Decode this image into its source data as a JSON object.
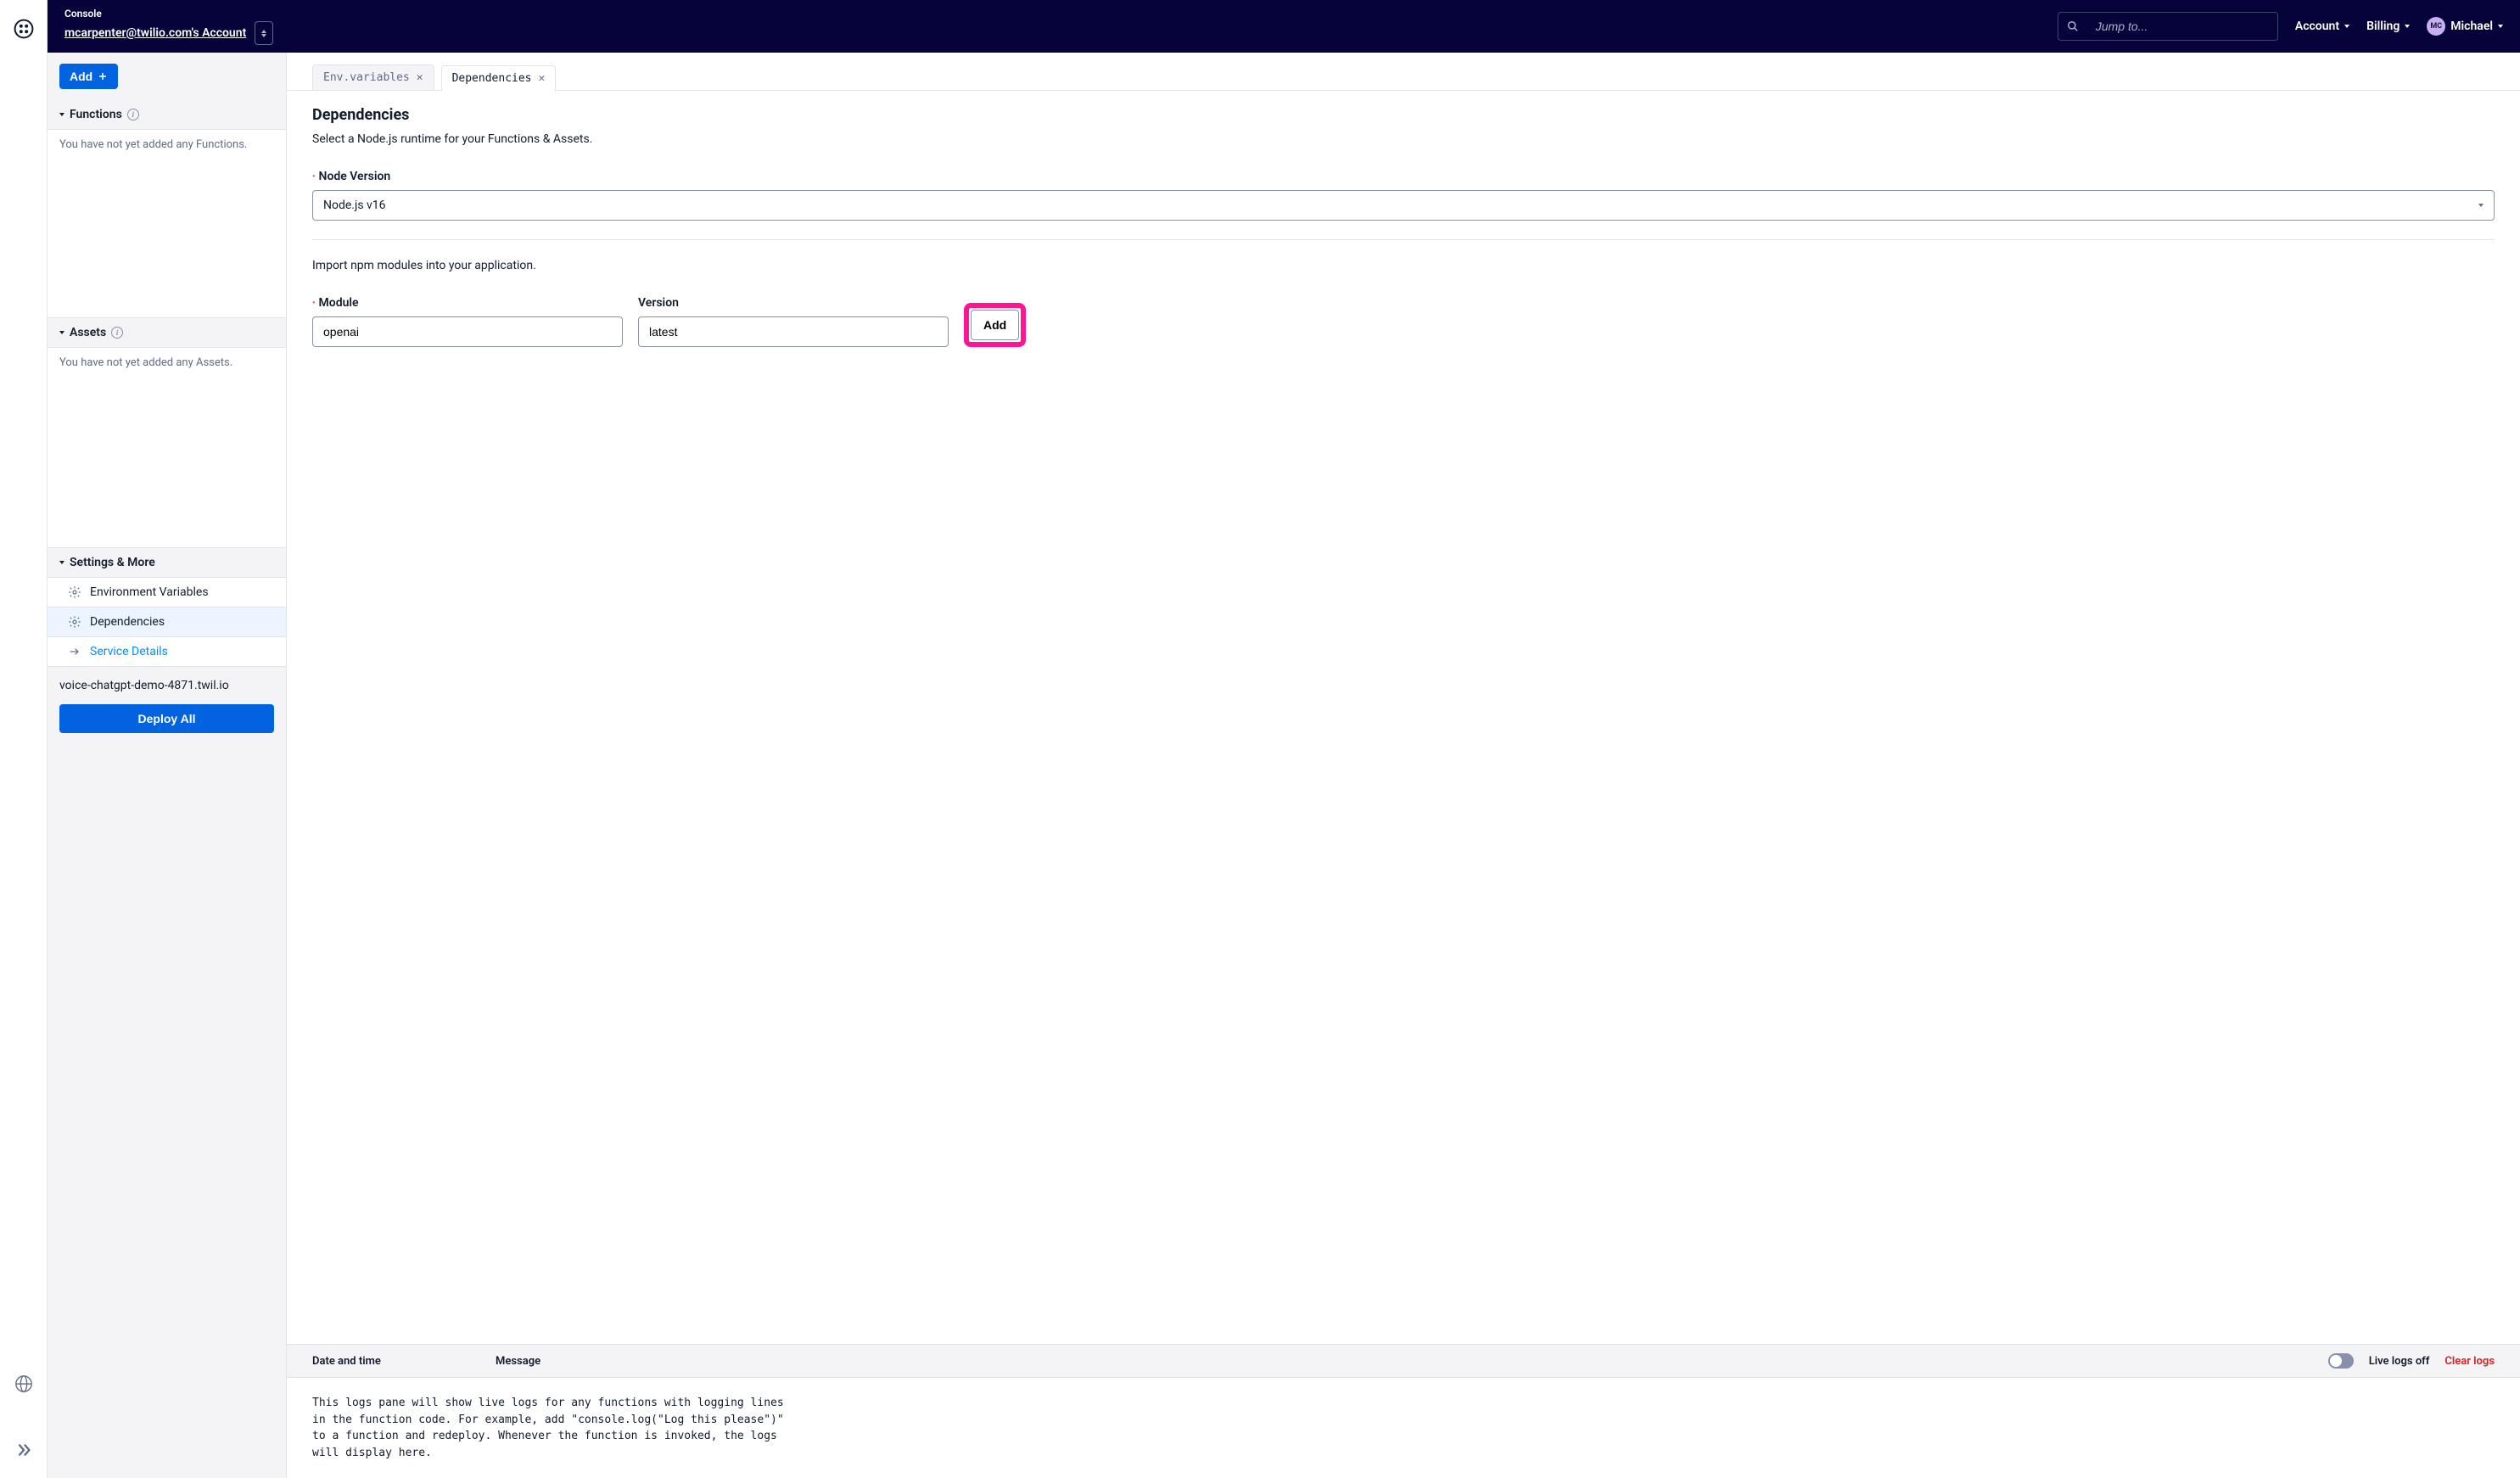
{
  "header": {
    "console_label": "Console",
    "account_label": "mcarpenter@twilio.com's Account",
    "search_placeholder": "Jump to...",
    "nav_account": "Account",
    "nav_billing": "Billing",
    "user_name": "Michael",
    "avatar_initials": "MC"
  },
  "sidebar": {
    "add_button": "Add",
    "sections": {
      "functions": {
        "title": "Functions",
        "empty": "You have not yet added any Functions."
      },
      "assets": {
        "title": "Assets",
        "empty": "You have not yet added any Assets."
      },
      "settings": {
        "title": "Settings & More"
      }
    },
    "settings_items": {
      "env": "Environment Variables",
      "deps": "Dependencies",
      "details": "Service Details"
    },
    "service_url": "voice-chatgpt-demo-4871.twil.io",
    "deploy_button": "Deploy All"
  },
  "tabs": {
    "env": "Env.variables",
    "deps": "Dependencies"
  },
  "panel": {
    "title": "Dependencies",
    "subtitle": "Select a Node.js runtime for your Functions & Assets.",
    "node_version_label": "Node Version",
    "node_version_value": "Node.js v16",
    "import_text": "Import npm modules into your application.",
    "module_label": "Module",
    "module_value": "openai",
    "version_label": "Version",
    "version_value": "latest",
    "add_button": "Add"
  },
  "logs": {
    "col_date": "Date and time",
    "col_msg": "Message",
    "live_label": "Live logs off",
    "clear_label": "Clear logs",
    "body": "This logs pane will show live logs for any functions with logging lines in the function code. For example, add \"console.log(\"Log this please\")\" to a function and redeploy. Whenever the function is invoked, the logs will display here."
  }
}
